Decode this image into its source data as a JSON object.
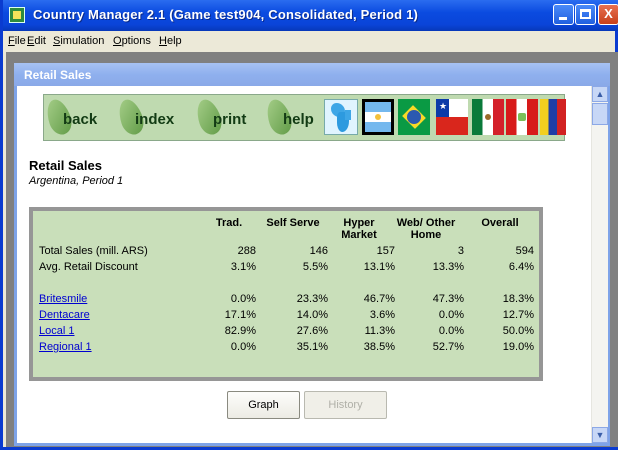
{
  "window": {
    "title": "Country Manager 2.1 (Game test904, Consolidated, Period 1)",
    "min_symbol": "",
    "max_symbol": "",
    "close_symbol": "X"
  },
  "menu": [
    "File",
    "Edit",
    "Simulation",
    "Options",
    "Help"
  ],
  "child_window": {
    "title": "Retail Sales"
  },
  "nav": {
    "back": "back",
    "index": "index",
    "print": "print",
    "help": "help"
  },
  "icons": [
    "map-icon",
    "argentina-flag-icon",
    "brazil-flag-icon",
    "chile-flag-icon",
    "mexico-flag-icon",
    "peru-flag-icon",
    "venezuela-flag-icon"
  ],
  "page": {
    "title": "Retail Sales",
    "subtitle": "Argentina, Period 1"
  },
  "table": {
    "headers": [
      "Trad.",
      "Self Serve",
      "Hyper\nMarket",
      "Web/ Other\nHome",
      "Overall"
    ],
    "header_lines": [
      [
        "Trad."
      ],
      [
        "Self Serve"
      ],
      [
        "Hyper",
        "Market"
      ],
      [
        "Web/ Other",
        "Home"
      ],
      [
        "Overall"
      ]
    ],
    "summary_rows": [
      {
        "label": "Total Sales (mill. ARS)",
        "values": [
          "288",
          "146",
          "157",
          "3",
          "594"
        ]
      },
      {
        "label": "Avg. Retail Discount",
        "values": [
          "3.1%",
          "5.5%",
          "13.1%",
          "13.3%",
          "6.4%"
        ]
      }
    ],
    "brand_rows": [
      {
        "label": "Britesmile",
        "values": [
          "0.0%",
          "23.3%",
          "46.7%",
          "47.3%",
          "18.3%"
        ]
      },
      {
        "label": "Dentacare",
        "values": [
          "17.1%",
          "14.0%",
          "3.6%",
          "0.0%",
          "12.7%"
        ]
      },
      {
        "label": "Local 1",
        "values": [
          "82.9%",
          "27.6%",
          "11.3%",
          "0.0%",
          "50.0%"
        ]
      },
      {
        "label": "Regional 1",
        "values": [
          "0.0%",
          "35.1%",
          "38.5%",
          "52.7%",
          "19.0%"
        ]
      }
    ]
  },
  "buttons": {
    "graph": "Graph",
    "history": "History"
  },
  "colors": {
    "table_bg": "#c9dfba",
    "nav_bg": "#bfdab0",
    "link": "#0000d0",
    "titlebar": "#0b4be0"
  }
}
